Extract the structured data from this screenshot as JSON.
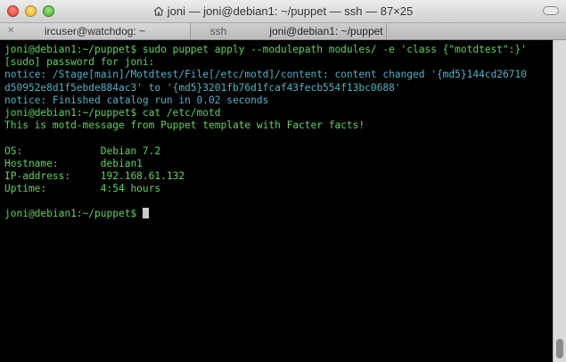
{
  "window": {
    "title": "joni — joni@debian1: ~/puppet — ssh — 87×25",
    "colors": {
      "prompt_green": "#5fd35f",
      "notice_cyan": "#4fb2c9",
      "background": "#000000"
    }
  },
  "tabs": [
    {
      "label": "ircuser@watchdog: ~"
    },
    {
      "label": "ssh"
    },
    {
      "label": "joni@debian1: ~/puppet"
    }
  ],
  "terminal": {
    "lines": [
      {
        "text": "joni@debian1:~/puppet$ sudo puppet apply --modulepath modules/ -e 'class {\"motdtest\":}'",
        "color": "green"
      },
      {
        "text": "[sudo] password for joni:",
        "color": "green"
      },
      {
        "text": "notice: /Stage[main]/Motdtest/File[/etc/motd]/content: content changed '{md5}144cd26710",
        "color": "cyan"
      },
      {
        "text": "d50952e8d1f5ebde884ac3' to '{md5}3201fb76d1fcaf43fecb554f13bc0688'",
        "color": "cyan"
      },
      {
        "text": "notice: Finished catalog run in 0.02 seconds",
        "color": "cyan"
      },
      {
        "text": "joni@debian1:~/puppet$ cat /etc/motd",
        "color": "green"
      },
      {
        "text": "This is motd-message from Puppet template with Facter facts!",
        "color": "green"
      },
      {
        "text": "",
        "color": "green"
      },
      {
        "text": "OS:             Debian 7.2",
        "color": "green"
      },
      {
        "text": "Hostname:       debian1",
        "color": "green"
      },
      {
        "text": "IP-address:     192.168.61.132",
        "color": "green"
      },
      {
        "text": "Uptime:         4:54 hours",
        "color": "green"
      },
      {
        "text": "",
        "color": "green"
      },
      {
        "text": "joni@debian1:~/puppet$ ",
        "color": "green"
      }
    ]
  }
}
